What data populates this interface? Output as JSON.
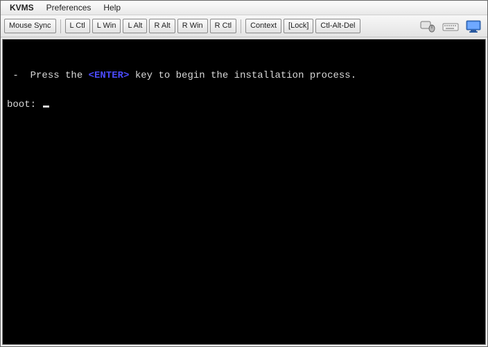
{
  "menubar": {
    "items": [
      "KVMS",
      "Preferences",
      "Help"
    ]
  },
  "toolbar": {
    "mouse_sync": "Mouse Sync",
    "l_ctl": "L Ctl",
    "l_win": "L Win",
    "l_alt": "L Alt",
    "r_alt": "R Alt",
    "r_win": "R Win",
    "r_ctl": "R Ctl",
    "context": "Context",
    "lock": "[Lock]",
    "ctl_alt_del": "Ctl-Alt-Del"
  },
  "console": {
    "dash": " -  ",
    "pre_text": "Press the ",
    "enter": "<ENTER>",
    "post_text": " key to begin the installation process.",
    "boot": "boot: "
  }
}
